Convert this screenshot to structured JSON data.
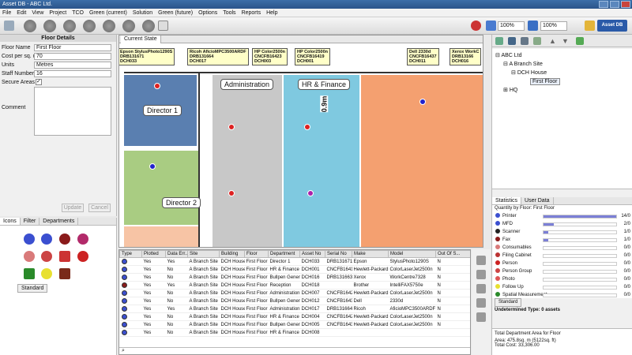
{
  "window": {
    "title": "Asset DB - ABC Ltd."
  },
  "menu": [
    "File",
    "Edit",
    "View",
    "Project",
    "TCO",
    "Green (current)",
    "Solution",
    "Green (future)",
    "Options",
    "Tools",
    "Reports",
    "Help"
  ],
  "toolbar": {
    "zoom1": "100%",
    "zoom2": "100%",
    "brand": "Asset DB"
  },
  "floor_details": {
    "title": "Floor Details",
    "fields": [
      {
        "label": "Floor Name",
        "value": "First Floor"
      },
      {
        "label": "Cost per sq. unit",
        "value": "70"
      },
      {
        "label": "Units",
        "value": "Metres"
      },
      {
        "label": "Staff Numbers",
        "value": "16"
      },
      {
        "label": "Secure Areas",
        "value": ""
      },
      {
        "label": "Comment",
        "value": ""
      }
    ],
    "update": "Update",
    "cancel": "Cancel"
  },
  "icon_tabs": [
    "Icons",
    "Filter",
    "Departments"
  ],
  "icon_standard": "Standard",
  "plan_tab": "Current State",
  "plan_labels": {
    "director1": "Director 1",
    "director2": "Director 2",
    "admin": "Administration",
    "hr": "HR & Finance",
    "dim": "0.9m"
  },
  "callouts": [
    "Epson StylusPhoto1290S\nDRB131671\nDCH033",
    "Ricoh AficioMPC3500ARDF\nDRB131664\nDCH017",
    "HP Color2500n\nCNCFB16423\nDCH003",
    "HP Color2500n\nCNCFB16419\nDCH001",
    "Dell 2330d\nCNCFB16437\nDCH011",
    "Xerox WorkC\nDRB13166\nDCH016"
  ],
  "table": {
    "headers": [
      "Type",
      "Plotted",
      "Data Err..",
      "Site",
      "Building",
      "Floor",
      "Department",
      "Asset No",
      "Serial No",
      "Make",
      "Model",
      "Out Of S..."
    ],
    "rows": [
      [
        "b",
        "Yes",
        "Yes",
        "A Branch Site",
        "DCH House",
        "First Floor",
        "Director 1",
        "DCH033",
        "DRB131671",
        "Epson",
        "StylusPhoto1290S",
        "N"
      ],
      [
        "b",
        "Yes",
        "No",
        "A Branch Site",
        "DCH House",
        "First Floor",
        "HR & Finance",
        "DCH001",
        "CNCFB16419",
        "Hewlett-Packard",
        "ColorLaserJet2500n",
        "N"
      ],
      [
        "b",
        "Yes",
        "No",
        "A Branch Site",
        "DCH House",
        "First Floor",
        "Bullpen General",
        "DCH016",
        "DRB131663",
        "Xerox",
        "WorkCentre7328",
        "N"
      ],
      [
        "r",
        "Yes",
        "Yes",
        "A Branch Site",
        "DCH House",
        "First Floor",
        "Reception",
        "DCH018",
        "",
        "Brother",
        "IntelliFAX5750e",
        "N"
      ],
      [
        "b",
        "Yes",
        "No",
        "A Branch Site",
        "DCH House",
        "First Floor",
        "Administration",
        "DCH007",
        "CNCFB16429",
        "Hewlett-Packard",
        "ColorLaserJet2500n",
        "N"
      ],
      [
        "b",
        "Yes",
        "No",
        "A Branch Site",
        "DCH House",
        "First Floor",
        "Bullpen General",
        "DCH012",
        "CNCFB16439",
        "Dell",
        "2330d",
        "N"
      ],
      [
        "b",
        "Yes",
        "Yes",
        "A Branch Site",
        "DCH House",
        "First Floor",
        "Administration",
        "DCH017",
        "DRB131664",
        "Ricoh",
        "AficioMPC3500ARDF",
        "N"
      ],
      [
        "b",
        "Yes",
        "No",
        "A Branch Site",
        "DCH House",
        "First Floor",
        "HR & Finance",
        "DCH004",
        "CNCFB16425",
        "Hewlett-Packard",
        "ColorLaserJet2500n",
        "N"
      ],
      [
        "b",
        "Yes",
        "No",
        "A Branch Site",
        "DCH House",
        "First Floor",
        "Bullpen General",
        "DCH005",
        "CNCFB16431",
        "Hewlett-Packard",
        "ColorLaserJet2500n",
        "N"
      ],
      [
        "b",
        "Yes",
        "No",
        "A Branch Site",
        "DCH House",
        "First Floor",
        "HR & Finance",
        "DCH008",
        "",
        "",
        "",
        ""
      ]
    ]
  },
  "tree": {
    "root": "ABC Ltd",
    "site": "A Branch Site",
    "building": "DCH House",
    "floor": "First Floor",
    "hq": "HQ"
  },
  "stats_tabs": [
    "Statistics",
    "User Data"
  ],
  "stats_title": "Quantity by Floor: First Floor",
  "stats": [
    {
      "label": "Printer",
      "value": "14/0",
      "frac": 1.0,
      "color": "#3b4fd0"
    },
    {
      "label": "MFD",
      "value": "2/0",
      "frac": 0.14,
      "color": "#3b4fd0"
    },
    {
      "label": "Scanner",
      "value": "1/0",
      "frac": 0.07,
      "color": "#222"
    },
    {
      "label": "Fax",
      "value": "1/0",
      "frac": 0.07,
      "color": "#8a1b1b"
    },
    {
      "label": "Consumables",
      "value": "0/0",
      "frac": 0,
      "color": "#d97a7a"
    },
    {
      "label": "Filing Cabinet",
      "value": "0/0",
      "frac": 0,
      "color": "#b33"
    },
    {
      "label": "Person",
      "value": "0/0",
      "frac": 0,
      "color": "#c22"
    },
    {
      "label": "Person Group",
      "value": "0/0",
      "frac": 0,
      "color": "#c44"
    },
    {
      "label": "Photo",
      "value": "0/0",
      "frac": 0,
      "color": "#d55"
    },
    {
      "label": "Follow Up",
      "value": "0/0",
      "frac": 0,
      "color": "#e8e030"
    },
    {
      "label": "Spatial Measurement",
      "value": "0/0",
      "frac": 0,
      "color": "#2a8a2a"
    }
  ],
  "stats_standard": "Standard",
  "undetermined": "Undetermined Type: 0 assets",
  "dept_area": {
    "title": "Total Department Area for Floor",
    "area": "Area: 475.8sq. m (5122sq. ft)",
    "cost": "Total Cost: 33,306.00"
  }
}
